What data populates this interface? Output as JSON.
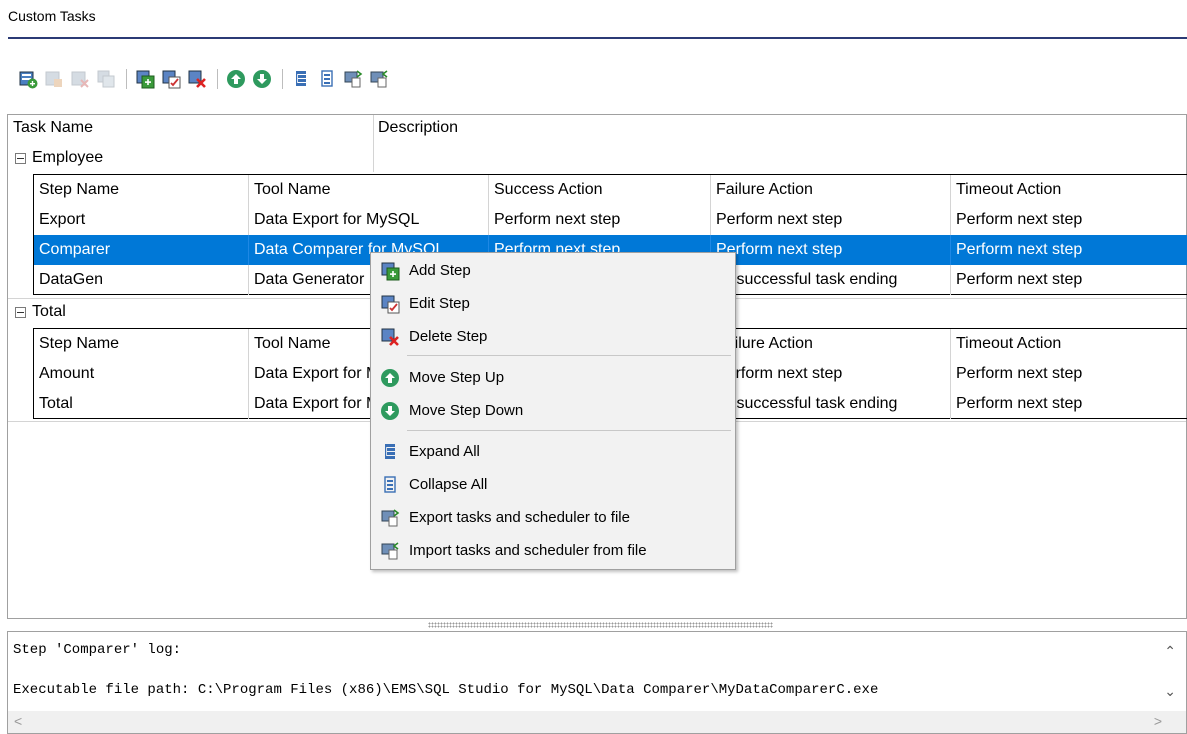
{
  "window": {
    "title": "Custom Tasks"
  },
  "toolbar": {
    "buttons": [
      {
        "icon": "add-task-icon",
        "enabled": true
      },
      {
        "icon": "edit-task-icon",
        "enabled": false
      },
      {
        "icon": "delete-task-icon",
        "enabled": false
      },
      {
        "icon": "duplicate-task-icon",
        "enabled": false
      },
      {
        "icon": "add-step-icon",
        "enabled": true
      },
      {
        "icon": "edit-step-icon",
        "enabled": true
      },
      {
        "icon": "delete-step-icon",
        "enabled": true
      },
      {
        "icon": "move-up-icon",
        "enabled": true
      },
      {
        "icon": "move-down-icon",
        "enabled": true
      },
      {
        "icon": "expand-all-icon",
        "enabled": true
      },
      {
        "icon": "collapse-all-icon",
        "enabled": true
      },
      {
        "icon": "export-icon",
        "enabled": true
      },
      {
        "icon": "import-icon",
        "enabled": true
      }
    ]
  },
  "grid": {
    "headers": {
      "task_name": "Task Name",
      "description": "Description"
    },
    "detail_headers": {
      "step_name": "Step Name",
      "tool_name": "Tool Name",
      "success_action": "Success Action",
      "failure_action": "Failure Action",
      "timeout_action": "Timeout Action"
    },
    "groups": [
      {
        "name": "Employee",
        "rows": [
          {
            "step": "Export",
            "tool": "Data Export for MySQL",
            "success": "Perform next step",
            "failure": "Perform next step",
            "timeout": "Perform next step",
            "selected": false
          },
          {
            "step": "Comparer",
            "tool": "Data Comparer for MySQL",
            "success": "Perform next step",
            "failure": "Perform next step",
            "timeout": "Perform next step",
            "selected": true
          },
          {
            "step": "DataGen",
            "tool": "Data Generator",
            "success": "",
            "failure": "Unsuccessful task ending",
            "timeout": "Perform next step",
            "selected": false
          }
        ]
      },
      {
        "name": "Total",
        "rows": [
          {
            "step": "Amount",
            "tool": "Data Export for MySQL",
            "success": "",
            "failure": "Perform next step",
            "timeout": "Perform next step",
            "selected": false
          },
          {
            "step": "Total",
            "tool": "Data Export for MySQL",
            "success": "",
            "failure": "Unsuccessful task ending",
            "timeout": "Perform next step",
            "selected": false
          }
        ]
      }
    ]
  },
  "context_menu": {
    "items": [
      {
        "label": "Add Step",
        "icon": "add-step-icon"
      },
      {
        "label": "Edit Step",
        "icon": "edit-step-icon"
      },
      {
        "label": "Delete Step",
        "icon": "delete-step-icon"
      },
      {
        "label": "Move Step Up",
        "icon": "move-up-icon"
      },
      {
        "label": "Move Step Down",
        "icon": "move-down-icon"
      },
      {
        "label": "Expand All",
        "icon": "expand-all-icon"
      },
      {
        "label": "Collapse All",
        "icon": "collapse-all-icon"
      },
      {
        "label": "Export tasks and scheduler to file",
        "icon": "export-icon"
      },
      {
        "label": "Import tasks and scheduler from file",
        "icon": "import-icon"
      }
    ]
  },
  "log": {
    "lines": [
      "Step 'Comparer' log:",
      "",
      "Executable file path: C:\\Program Files (x86)\\EMS\\SQL Studio for MySQL\\Data Comparer\\MyDataComparerC.exe"
    ]
  },
  "colors": {
    "selection": "#0078d7",
    "accent_rule": "#2b3a75"
  }
}
